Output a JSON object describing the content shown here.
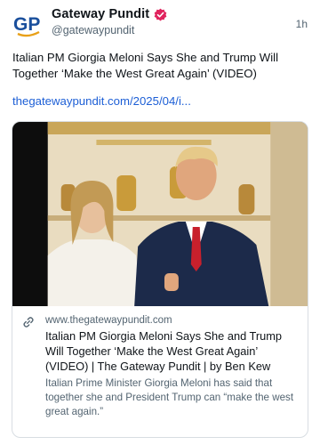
{
  "author": {
    "name": "Gateway Pundit",
    "handle": "@gatewaypundit",
    "avatar_text": "GP",
    "verified": true
  },
  "timestamp": "1h",
  "post": {
    "text": "Italian PM Giorgia Meloni Says She and Trump Will Together ‘Make the West Great Again’ (VIDEO)",
    "link_text": "thegatewaypundit.com/2025/04/i..."
  },
  "card": {
    "domain": "www.thegatewaypundit.com",
    "title": "Italian PM Giorgia Meloni Says She and Trump Will Together ‘Make the West Great Again’ (VIDEO) | The Gateway Pundit | by Ben Kew",
    "description": "Italian Prime Minister Giorgia Meloni has said that together she and President Trump can “make the west great again.”",
    "image_icon": "photo-of-two-people"
  },
  "colors": {
    "brand_blue": "#1d5fd6",
    "verified_red": "#e0245e",
    "text_primary": "#0f1419",
    "text_secondary": "#536471",
    "card_border": "#d8dde2"
  }
}
